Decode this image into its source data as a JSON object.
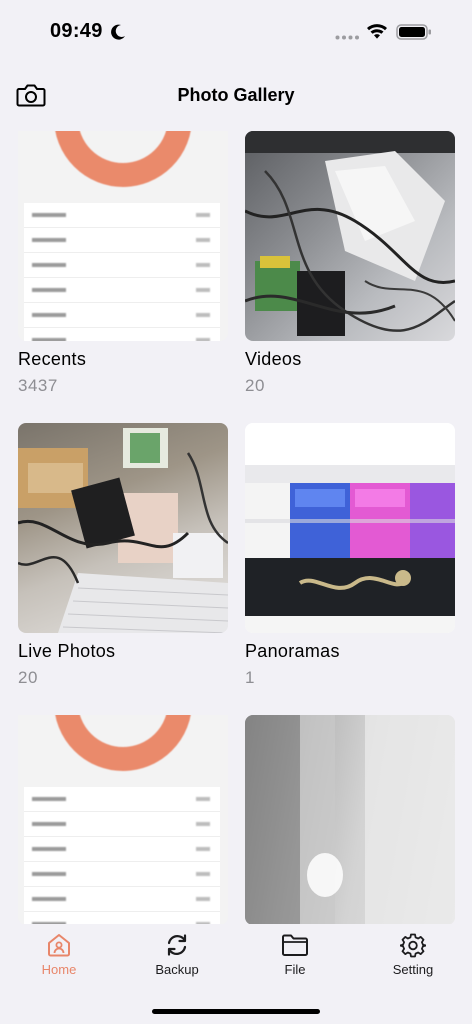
{
  "status": {
    "time": "09:49"
  },
  "header": {
    "title": "Photo Gallery"
  },
  "albums": [
    {
      "title": "Recents",
      "count": "3437"
    },
    {
      "title": "Videos",
      "count": "20"
    },
    {
      "title": "Live Photos",
      "count": "20"
    },
    {
      "title": "Panoramas",
      "count": "1"
    }
  ],
  "tabs": [
    {
      "label": "Home",
      "icon": "home-icon"
    },
    {
      "label": "Backup",
      "icon": "sync-icon"
    },
    {
      "label": "File",
      "icon": "folder-icon"
    },
    {
      "label": "Setting",
      "icon": "gear-icon"
    }
  ],
  "colors": {
    "accent": "#e8866a",
    "background": "#f2f1f6",
    "secondary_text": "#8e8e93"
  }
}
